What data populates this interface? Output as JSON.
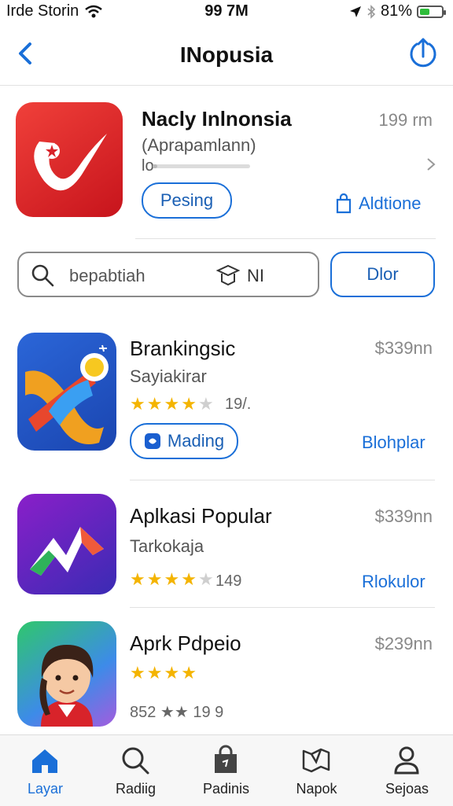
{
  "status_bar": {
    "carrier": "Irde Storin",
    "time": "99 7M",
    "battery": "81%"
  },
  "nav": {
    "title": "INopusia",
    "back_icon": "chevron-left-icon",
    "share_icon": "refresh-share-icon"
  },
  "featured": {
    "name": "Nacly Inlnonsia",
    "subtitle": "(Aprapamlann)",
    "progress_label": "lo",
    "progress": 0.05,
    "size": "199 rm",
    "primary_button": "Pesing",
    "secondary_link": "Aldtione"
  },
  "search": {
    "value": "bepabtiah",
    "tool_label": "NI",
    "filter_button": "Dlor"
  },
  "apps": [
    {
      "name": "Brankingsic",
      "subtitle": "Sayiakirar",
      "price": "$339nn",
      "rating": 4,
      "rating_count": "19/.",
      "button": "Mading",
      "link": "Blohplar"
    },
    {
      "name": "Aplkasi Popular",
      "subtitle": "Tarkokaja",
      "price": "$339nn",
      "rating": 4,
      "rating_count": "149",
      "link": "Rlokulor"
    },
    {
      "name": "Aprk Pdpeio",
      "subtitle": "",
      "price": "$239nn",
      "rating": 4,
      "meta": "852 ★★ 19 9"
    }
  ],
  "tabs": [
    {
      "label": "Layar",
      "icon": "home-icon",
      "active": true
    },
    {
      "label": "Radiig",
      "icon": "search-icon",
      "active": false
    },
    {
      "label": "Padinis",
      "icon": "bag-icon",
      "active": false
    },
    {
      "label": "Napok",
      "icon": "map-icon",
      "active": false
    },
    {
      "label": "Sejoas",
      "icon": "person-icon",
      "active": false
    }
  ],
  "colors": {
    "accent": "#1a6fd8",
    "star": "#f4b400",
    "featured_icon": "#d8232a"
  }
}
